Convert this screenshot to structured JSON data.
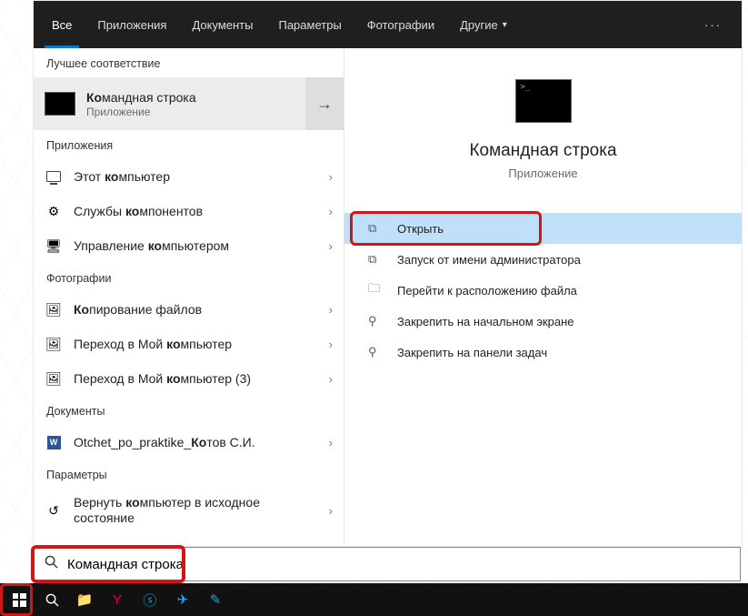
{
  "tabs": {
    "all": "Все",
    "apps": "Приложения",
    "docs": "Документы",
    "params": "Параметры",
    "photos": "Фотографии",
    "other": "Другие"
  },
  "sections": {
    "best": "Лучшее соответствие",
    "apps": "Приложения",
    "photos": "Фотографии",
    "docs": "Документы",
    "params": "Параметры"
  },
  "best_match": {
    "title": "Командная строка",
    "title_prefix": "Ко",
    "subtitle": "Приложение"
  },
  "apps_list": [
    {
      "label": "Этот компьютер",
      "hl": "ко"
    },
    {
      "label": "Службы компонентов",
      "hl": "ко"
    },
    {
      "label": "Управление компьютером",
      "hl": "ко"
    }
  ],
  "photos_list": [
    {
      "label": "Копирование файлов",
      "hl": "Ко"
    },
    {
      "label": "Переход в Мой компьютер",
      "hl": "ко"
    },
    {
      "label": "Переход в Мой компьютер (3)",
      "hl": "ко"
    }
  ],
  "docs_list": [
    {
      "label": "Otchet_po_praktike_Котов С.И.",
      "hl": "Ко"
    }
  ],
  "params_list": [
    {
      "label": "Вернуть компьютер в исходное состояние",
      "hl": "ко"
    }
  ],
  "preview": {
    "title": "Командная строка",
    "subtitle": "Приложение"
  },
  "actions": {
    "open": "Открыть",
    "runas": "Запуск от имени администратора",
    "location": "Перейти к расположению файла",
    "pin_start": "Закрепить на начальном экране",
    "pin_taskbar": "Закрепить на панели задач"
  },
  "search": {
    "value": "Командная строка",
    "placeholder": ""
  }
}
